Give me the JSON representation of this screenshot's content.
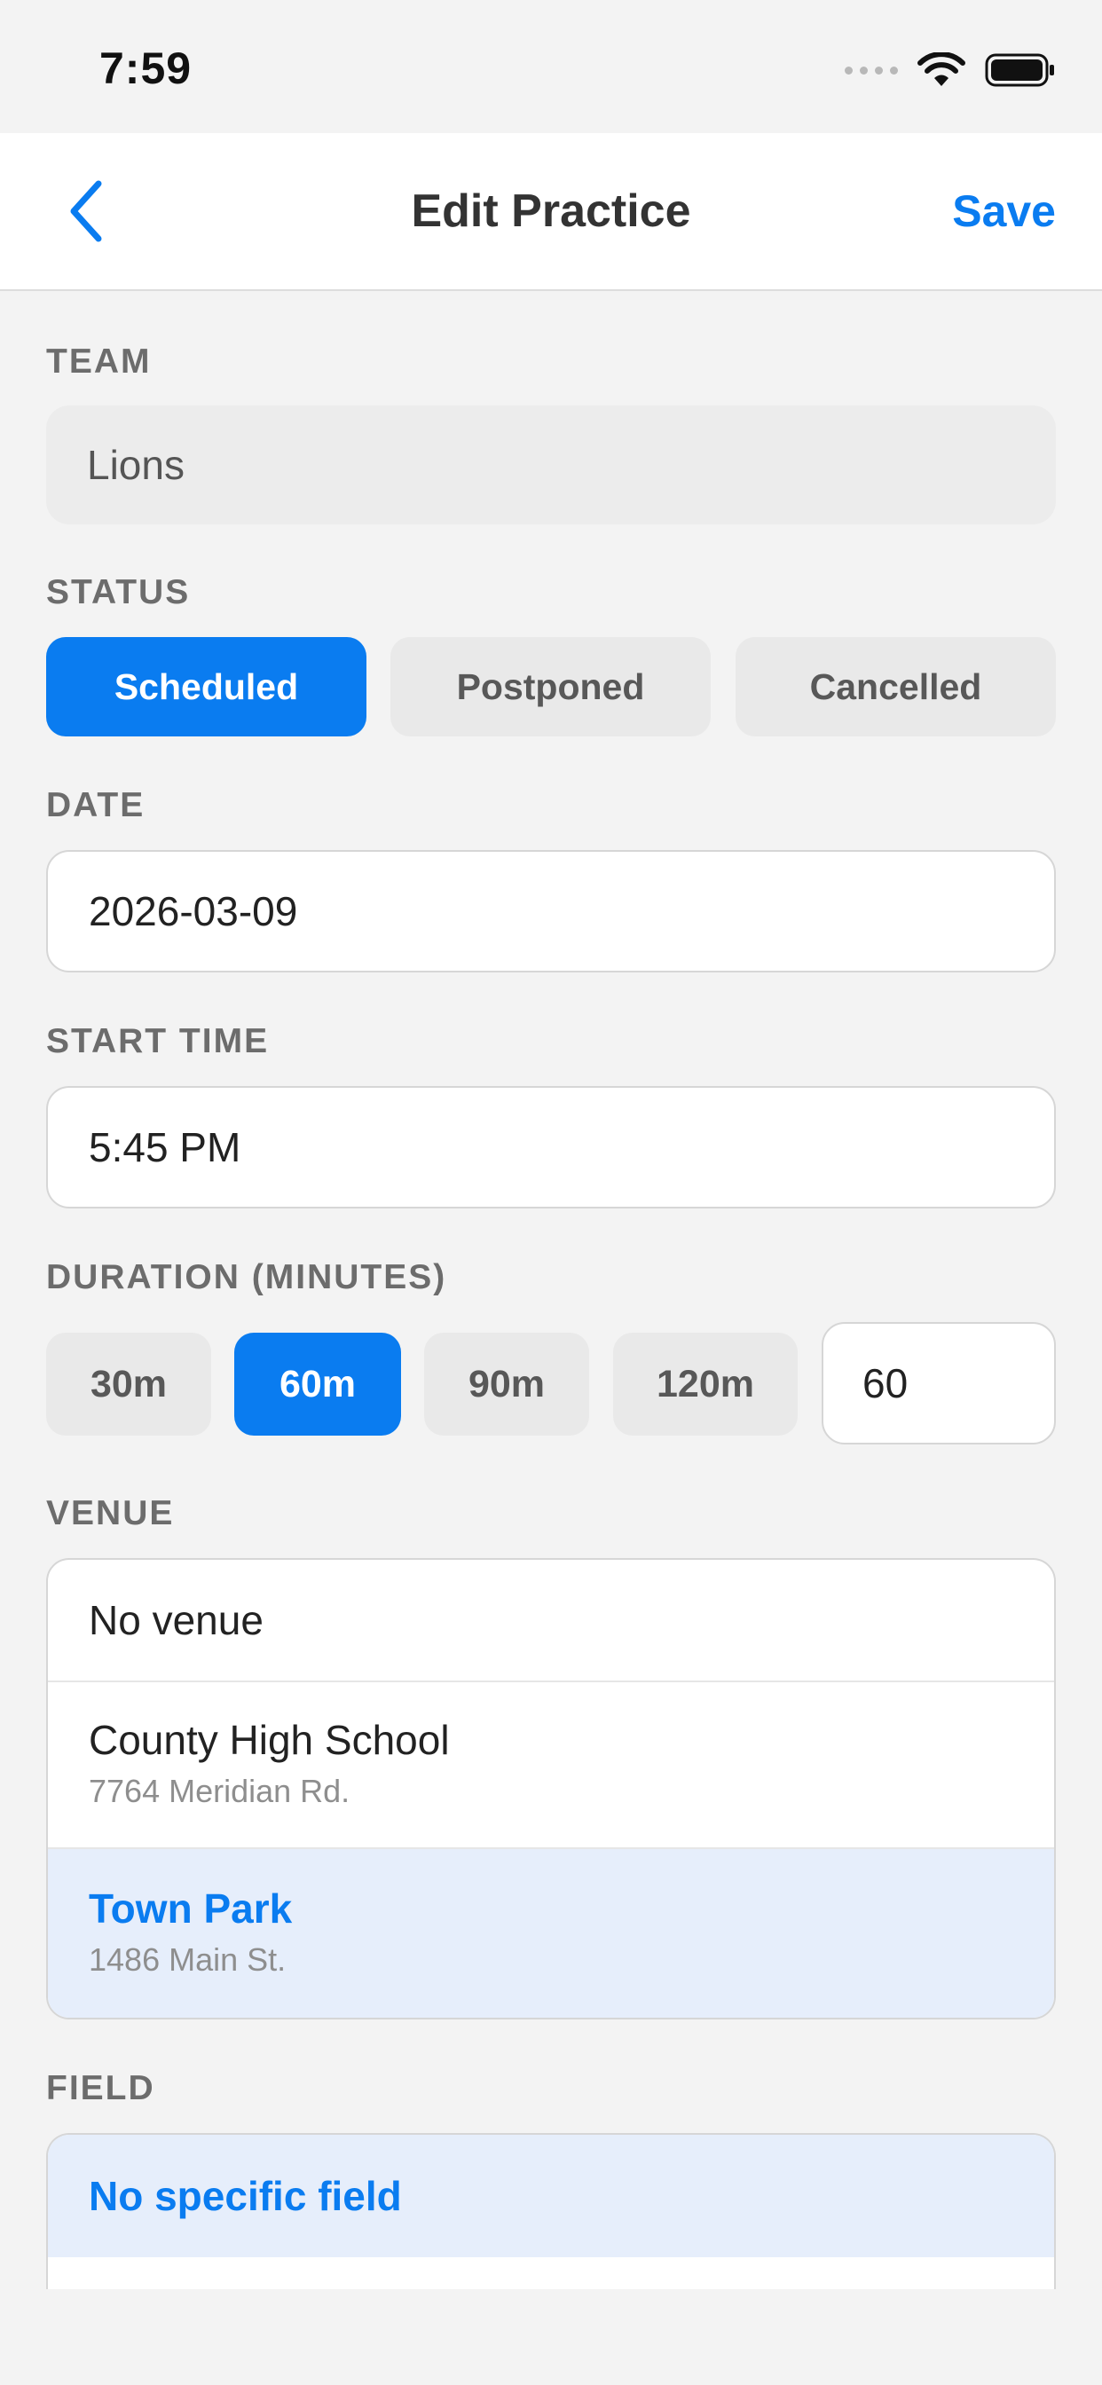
{
  "status_bar": {
    "time": "7:59"
  },
  "nav": {
    "title": "Edit Practice",
    "save_label": "Save"
  },
  "team": {
    "label": "TEAM",
    "value": "Lions"
  },
  "status": {
    "label": "STATUS",
    "options": [
      "Scheduled",
      "Postponed",
      "Cancelled"
    ],
    "selected": "Scheduled"
  },
  "date": {
    "label": "DATE",
    "value": "2026-03-09"
  },
  "start_time": {
    "label": "START TIME",
    "value": "5:45 PM"
  },
  "duration": {
    "label": "DURATION (MINUTES)",
    "options": [
      "30m",
      "60m",
      "90m",
      "120m"
    ],
    "selected": "60m",
    "custom_value": "60"
  },
  "venue": {
    "label": "VENUE",
    "options": [
      {
        "name": "No venue",
        "address": ""
      },
      {
        "name": "County High School",
        "address": "7764 Meridian Rd."
      },
      {
        "name": "Town Park",
        "address": "1486 Main St."
      }
    ],
    "selected": "Town Park"
  },
  "field": {
    "label": "FIELD",
    "options": [
      "No specific field"
    ],
    "selected": "No specific field"
  },
  "colors": {
    "accent": "#0a7cf0",
    "selected_row_bg": "#e6eefb",
    "background": "#f3f3f3"
  }
}
